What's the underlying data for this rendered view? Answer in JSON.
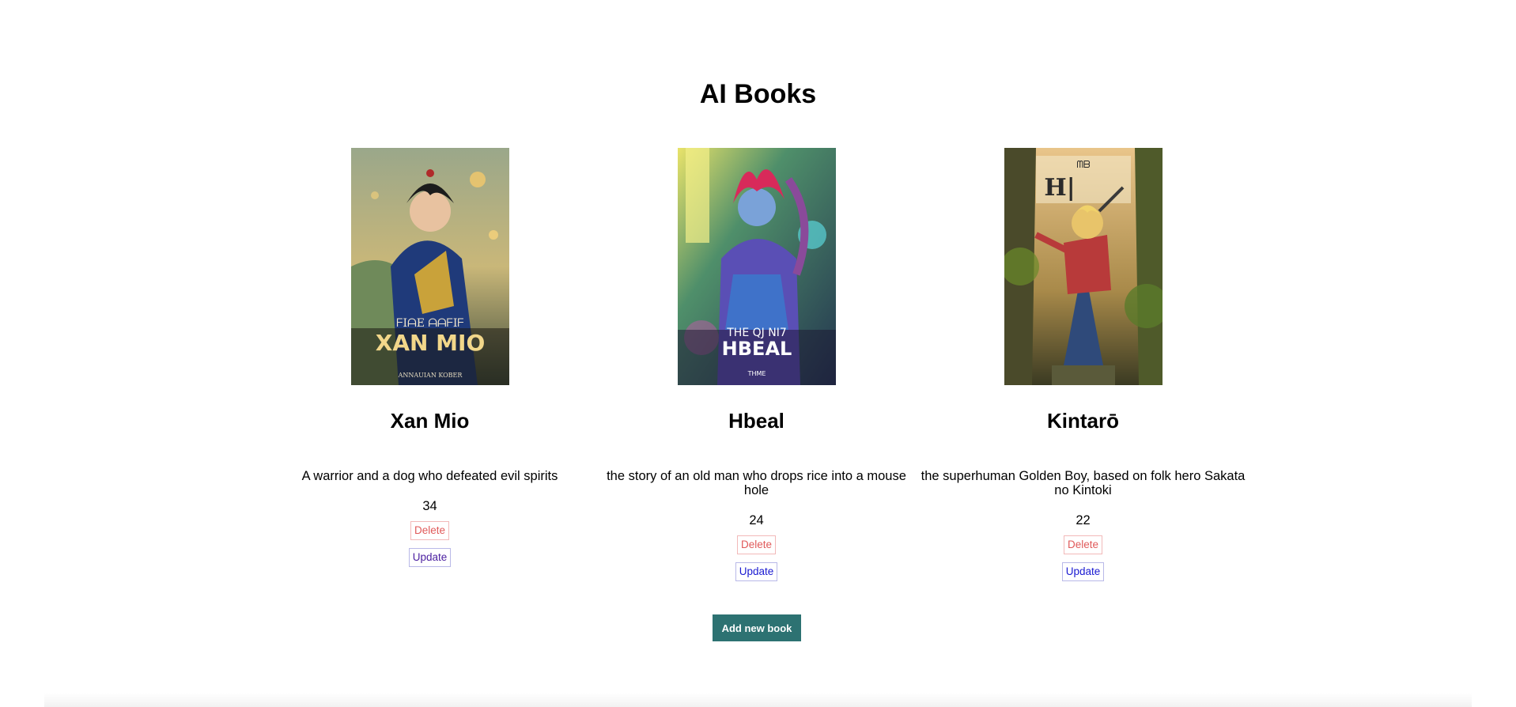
{
  "page": {
    "title": "AI Books"
  },
  "books": [
    {
      "cover_text_top": "ᖴIᗩE ᗩᗩᖴIᖴ",
      "cover_text_main": "XAN MIO",
      "cover_text_sub": "ANNAUIAN KOBER",
      "title": "Xan Mio",
      "description": "A warrior and a dog who defeated evil spirits",
      "price": "34",
      "delete_label": "Delete",
      "update_label": "Update"
    },
    {
      "cover_text_top": "THE QJ NI7",
      "cover_text_main": "HBEAL",
      "cover_text_sub": "THME",
      "title": "Hbeal",
      "description": "the story of an old man who drops rice into a mouse hole",
      "price": "24",
      "delete_label": "Delete",
      "update_label": "Update"
    },
    {
      "cover_text_top": "ᗰᗷ",
      "cover_text_main": "H|",
      "cover_text_sub": "",
      "title": "Kintarō",
      "description": "the superhuman Golden Boy, based on folk hero Sakata no Kintoki",
      "price": "22",
      "delete_label": "Delete",
      "update_label": "Update"
    }
  ],
  "actions": {
    "add_book_label": "Add new book"
  },
  "colors": {
    "add_button_bg": "#2d7272",
    "delete_text": "#e05a5a",
    "update_text": "#1a1ad1"
  }
}
